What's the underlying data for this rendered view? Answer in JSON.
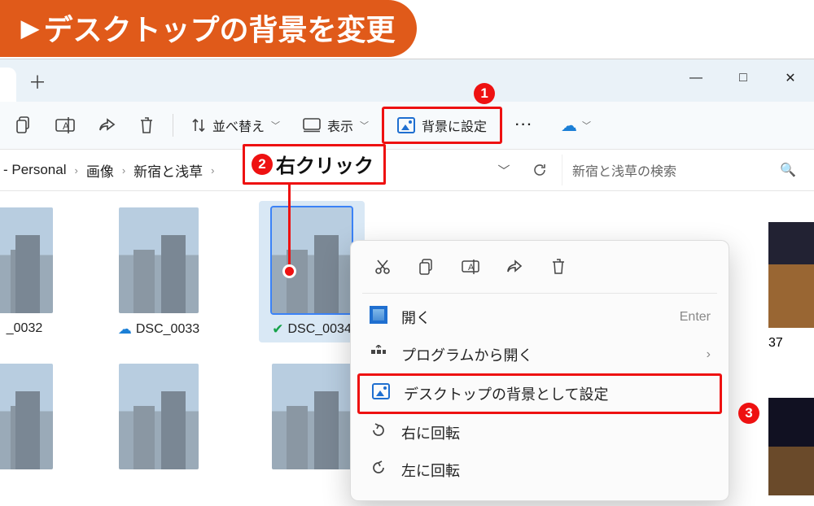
{
  "banner": {
    "title": "デスクトップの背景を変更"
  },
  "window_controls": {
    "min": "—",
    "max": "□",
    "close": "✕"
  },
  "toolbar": {
    "sort": "並べ替え",
    "view": "表示",
    "set_bg": "背景に設定",
    "more": "···"
  },
  "callouts": {
    "one": "1",
    "two": "2",
    "two_label": "右クリック",
    "three": "3"
  },
  "breadcrumb": {
    "root": "- Personal",
    "b1": "画像",
    "b2": "新宿と浅草"
  },
  "search": {
    "placeholder": "新宿と浅草の検索"
  },
  "thumbs": {
    "t1": "_0032",
    "t2": "DSC_0033",
    "t3": "DSC_0034",
    "t_far": "37"
  },
  "ctx": {
    "open": "開く",
    "open_hint": "Enter",
    "open_with": "プログラムから開く",
    "set_desktop": "デスクトップの背景として設定",
    "rot_r": "右に回転",
    "rot_l": "左に回転"
  }
}
